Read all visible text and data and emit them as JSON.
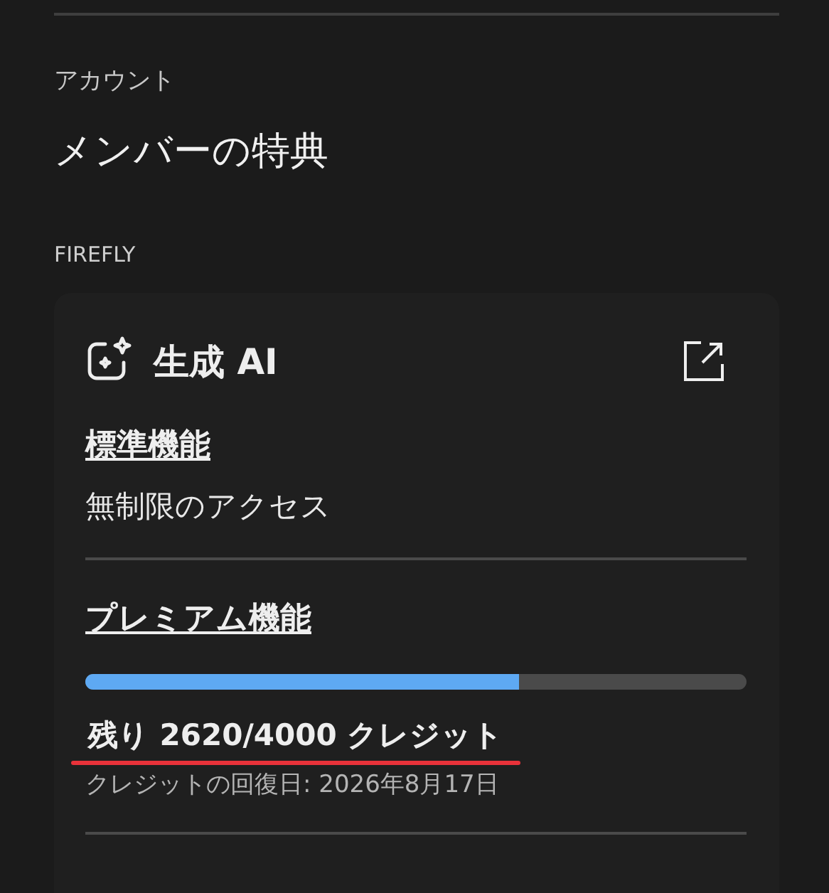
{
  "section_label": "アカウント",
  "page_title": "メンバーの特典",
  "group_label": "FIREFLY",
  "card": {
    "title": "生成 AI",
    "standard": {
      "heading": "標準機能",
      "description": "無制限のアクセス"
    },
    "premium": {
      "heading": "プレミアム機能",
      "level": 0.655,
      "credits": "残り 2620/4000 クレジット",
      "credits_highlighted": true,
      "renewal": "クレジットの回復日: 2026年8月17日"
    }
  }
}
